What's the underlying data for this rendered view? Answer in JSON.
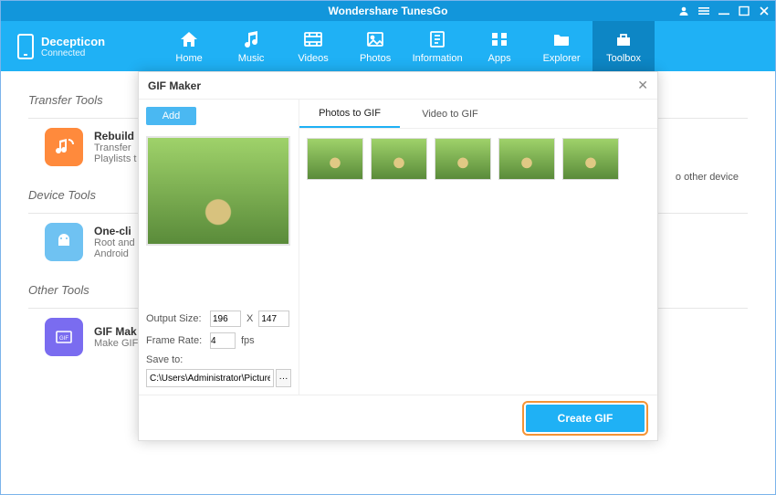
{
  "app": {
    "title": "Wondershare TunesGo"
  },
  "device": {
    "name": "Decepticon",
    "status": "Connected"
  },
  "nav": {
    "home": "Home",
    "music": "Music",
    "videos": "Videos",
    "photos": "Photos",
    "information": "Information",
    "apps": "Apps",
    "explorer": "Explorer",
    "toolbox": "Toolbox"
  },
  "sections": {
    "transfer": "Transfer Tools",
    "device": "Device Tools",
    "other": "Other Tools"
  },
  "tools": {
    "rebuild": {
      "title": "Rebuild",
      "desc1": "Transfer",
      "desc2": "Playlists t"
    },
    "oneclick": {
      "title": "One-cli",
      "desc1": "Root and",
      "desc2": "Android"
    },
    "gifmaker": {
      "title": "GIF Mak",
      "desc1": "Make GIF"
    },
    "sidetext": "o other device"
  },
  "modal": {
    "title": "GIF Maker",
    "add": "Add",
    "subtabs": {
      "photos": "Photos to GIF",
      "video": "Video to GIF"
    },
    "output_label": "Output Size:",
    "output_w": "196",
    "output_x": "X",
    "output_h": "147",
    "frame_label": "Frame Rate:",
    "frame_val": "4",
    "frame_unit": "fps",
    "save_label": "Save to:",
    "save_path": "C:\\Users\\Administrator\\Pictures\\",
    "browse": "···",
    "create": "Create GIF"
  }
}
